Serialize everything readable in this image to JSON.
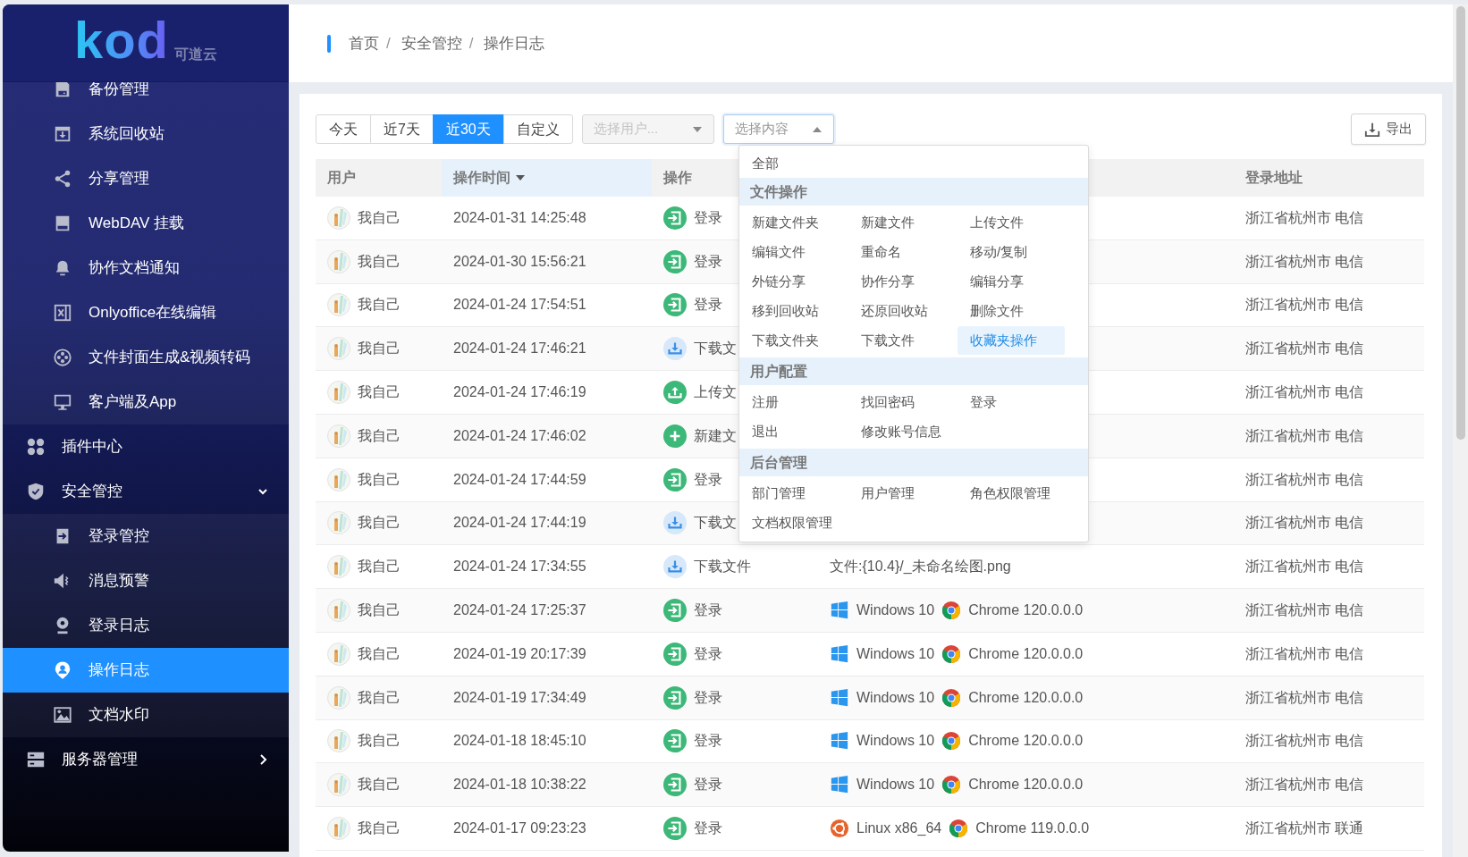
{
  "sidebar": {
    "logo": {
      "wordmark": "kod",
      "subtitle": "可道云"
    },
    "items": [
      {
        "kind": "group",
        "children": [
          {
            "label": "备份管理",
            "selected": false
          },
          {
            "label": "系统回收站",
            "selected": false
          },
          {
            "label": "分享管理",
            "selected": false
          },
          {
            "label": "WebDAV 挂载",
            "selected": false
          },
          {
            "label": "协作文档通知",
            "selected": false
          },
          {
            "label": "Onlyoffice在线编辑",
            "selected": false
          },
          {
            "label": "文件封面生成&视频转码",
            "selected": false
          },
          {
            "label": "客户端及App",
            "selected": false
          }
        ]
      },
      {
        "kind": "link",
        "label": "插件中心",
        "selected": false
      },
      {
        "kind": "group",
        "label": "安全管控",
        "selected": false,
        "expanded": true,
        "children": [
          {
            "label": "登录管控",
            "selected": false
          },
          {
            "label": "消息预警",
            "selected": false
          },
          {
            "label": "登录日志",
            "selected": false
          },
          {
            "label": "操作日志",
            "selected": true
          },
          {
            "label": "文档水印",
            "selected": false
          }
        ]
      },
      {
        "kind": "group",
        "label": "服务器管理",
        "selected": false,
        "expanded": false
      }
    ]
  },
  "breadcrumb": [
    {
      "label": "首页",
      "separator": "/"
    },
    {
      "label": "安全管控",
      "separator": "/"
    },
    {
      "label": "操作日志"
    }
  ],
  "filters": {
    "periods": [
      {
        "label": "今天",
        "selected": false
      },
      {
        "label": "近7天",
        "selected": false
      },
      {
        "label": "近30天",
        "selected": true
      },
      {
        "label": "自定义",
        "selected": false
      }
    ],
    "user_select": {
      "placeholder": "选择用户...",
      "disabled": true
    },
    "content_select": {
      "placeholder": "选择内容",
      "open": true
    },
    "export_button": {
      "label": "导出"
    }
  },
  "content_menu": {
    "all": {
      "label": "全部",
      "selected": false
    },
    "groups": [
      {
        "title": "文件操作",
        "options": [
          {
            "label": "新建文件夹",
            "selected": false
          },
          {
            "label": "新建文件",
            "selected": false
          },
          {
            "label": "上传文件",
            "selected": false
          },
          {
            "label": "编辑文件",
            "selected": false
          },
          {
            "label": "重命名",
            "selected": false
          },
          {
            "label": "移动/复制",
            "selected": false
          },
          {
            "label": "外链分享",
            "selected": false
          },
          {
            "label": "协作分享",
            "selected": false
          },
          {
            "label": "编辑分享",
            "selected": false
          },
          {
            "label": "移到回收站",
            "selected": false
          },
          {
            "label": "还原回收站",
            "selected": false
          },
          {
            "label": "删除文件",
            "selected": false
          },
          {
            "label": "下载文件夹",
            "selected": false
          },
          {
            "label": "下载文件",
            "selected": false
          },
          {
            "label": "收藏夹操作",
            "selected": true
          }
        ]
      },
      {
        "title": "用户配置",
        "options": [
          {
            "label": "注册",
            "selected": false
          },
          {
            "label": "找回密码",
            "selected": false
          },
          {
            "label": "登录",
            "selected": false
          },
          {
            "label": "退出",
            "selected": false
          },
          {
            "label": "修改账号信息",
            "selected": false
          }
        ]
      },
      {
        "title": "后台管理",
        "options": [
          {
            "label": "部门管理",
            "selected": false
          },
          {
            "label": "用户管理",
            "selected": false
          },
          {
            "label": "角色权限管理",
            "selected": false
          },
          {
            "label": "文档权限管理",
            "selected": false
          }
        ]
      }
    ]
  },
  "table": {
    "columns": [
      {
        "label": "用户",
        "sorted": false
      },
      {
        "label": "操作时间",
        "sorted": true
      },
      {
        "label": "操作",
        "sorted": false
      },
      {
        "label": "登录地址",
        "sorted": false
      }
    ],
    "rows": [
      {
        "user": "我自己",
        "time": "2024-01-31 14:25:48",
        "action": {
          "kind": "login",
          "label": "登录"
        },
        "address": "浙江省杭州市 电信"
      },
      {
        "user": "我自己",
        "time": "2024-01-30 15:56:21",
        "action": {
          "kind": "login",
          "label": "登录"
        },
        "address": "浙江省杭州市 电信"
      },
      {
        "user": "我自己",
        "time": "2024-01-24 17:54:51",
        "action": {
          "kind": "login",
          "label": "登录"
        },
        "address": "浙江省杭州市 电信"
      },
      {
        "user": "我自己",
        "time": "2024-01-24 17:46:21",
        "action": {
          "kind": "download",
          "label": "下载文"
        },
        "address": "浙江省杭州市 电信"
      },
      {
        "user": "我自己",
        "time": "2024-01-24 17:46:19",
        "action": {
          "kind": "upload",
          "label": "上传文"
        },
        "address": "浙江省杭州市 电信"
      },
      {
        "user": "我自己",
        "time": "2024-01-24 17:46:02",
        "action": {
          "kind": "create",
          "label": "新建文"
        },
        "address": "浙江省杭州市 电信"
      },
      {
        "user": "我自己",
        "time": "2024-01-24 17:44:59",
        "action": {
          "kind": "login",
          "label": "登录"
        },
        "address": "浙江省杭州市 电信"
      },
      {
        "user": "我自己",
        "time": "2024-01-24 17:44:19",
        "action": {
          "kind": "download",
          "label": "下载文"
        },
        "address": "浙江省杭州市 电信"
      },
      {
        "user": "我自己",
        "time": "2024-01-24 17:34:55",
        "action": {
          "kind": "download",
          "label": "下载文件"
        },
        "detail": {
          "kind": "file",
          "text": "文件:{10.4}/_未命名绘图.png"
        },
        "address": "浙江省杭州市 电信"
      },
      {
        "user": "我自己",
        "time": "2024-01-24 17:25:37",
        "action": {
          "kind": "login",
          "label": "登录"
        },
        "detail": {
          "kind": "windows",
          "os": "Windows 10",
          "browser": "Chrome 120.0.0.0"
        },
        "address": "浙江省杭州市 电信"
      },
      {
        "user": "我自己",
        "time": "2024-01-19 20:17:39",
        "action": {
          "kind": "login",
          "label": "登录"
        },
        "detail": {
          "kind": "windows",
          "os": "Windows 10",
          "browser": "Chrome 120.0.0.0"
        },
        "address": "浙江省杭州市 电信"
      },
      {
        "user": "我自己",
        "time": "2024-01-19 17:34:49",
        "action": {
          "kind": "login",
          "label": "登录"
        },
        "detail": {
          "kind": "windows",
          "os": "Windows 10",
          "browser": "Chrome 120.0.0.0"
        },
        "address": "浙江省杭州市 电信"
      },
      {
        "user": "我自己",
        "time": "2024-01-18 18:45:10",
        "action": {
          "kind": "login",
          "label": "登录"
        },
        "detail": {
          "kind": "windows",
          "os": "Windows 10",
          "browser": "Chrome 120.0.0.0"
        },
        "address": "浙江省杭州市 电信"
      },
      {
        "user": "我自己",
        "time": "2024-01-18 10:38:22",
        "action": {
          "kind": "login",
          "label": "登录"
        },
        "detail": {
          "kind": "windows",
          "os": "Windows 10",
          "browser": "Chrome 120.0.0.0"
        },
        "address": "浙江省杭州市 电信"
      },
      {
        "user": "我自己",
        "time": "2024-01-17 09:23:23",
        "action": {
          "kind": "login",
          "label": "登录"
        },
        "detail": {
          "kind": "linux",
          "os": "Linux x86_64",
          "browser": "Chrome 119.0.0.0"
        },
        "address": "浙江省杭州市 联通"
      }
    ]
  }
}
